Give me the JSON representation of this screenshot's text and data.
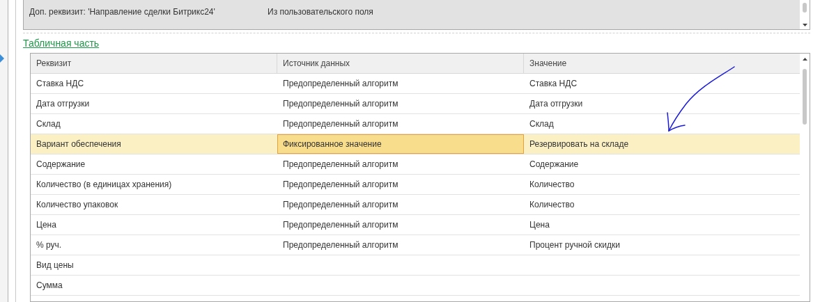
{
  "top_table": {
    "rows": [
      {
        "attribute": "Доп. реквизит: 'Направление сделки Битрикс24'",
        "source": "Из пользовательского поля"
      }
    ]
  },
  "section_link": "Табличная часть",
  "table": {
    "columns": [
      "Реквизит",
      "Источник данных",
      "Значение"
    ],
    "rows": [
      {
        "attribute": "Ставка НДС",
        "source": "Предопределенный алгоритм",
        "value": "Ставка НДС",
        "selected": false
      },
      {
        "attribute": "Дата отгрузки",
        "source": "Предопределенный алгоритм",
        "value": "Дата отгрузки",
        "selected": false
      },
      {
        "attribute": "Склад",
        "source": "Предопределенный алгоритм",
        "value": "Склад",
        "selected": false
      },
      {
        "attribute": "Вариант обеспечения",
        "source": "Фиксированное значение",
        "value": "Резервировать на складе",
        "selected": true
      },
      {
        "attribute": "Содержание",
        "source": "Предопределенный алгоритм",
        "value": "Содержание",
        "selected": false
      },
      {
        "attribute": "Количество (в единицах хранения)",
        "source": "Предопределенный алгоритм",
        "value": "Количество",
        "selected": false
      },
      {
        "attribute": "Количество упаковок",
        "source": "Предопределенный алгоритм",
        "value": "Количество",
        "selected": false
      },
      {
        "attribute": "Цена",
        "source": "Предопределенный алгоритм",
        "value": "Цена",
        "selected": false
      },
      {
        "attribute": "% руч.",
        "source": "Предопределенный алгоритм",
        "value": "Процент ручной скидки",
        "selected": false
      },
      {
        "attribute": "Вид цены",
        "source": "",
        "value": "",
        "selected": false
      },
      {
        "attribute": "Сумма",
        "source": "",
        "value": "",
        "selected": false
      }
    ]
  }
}
